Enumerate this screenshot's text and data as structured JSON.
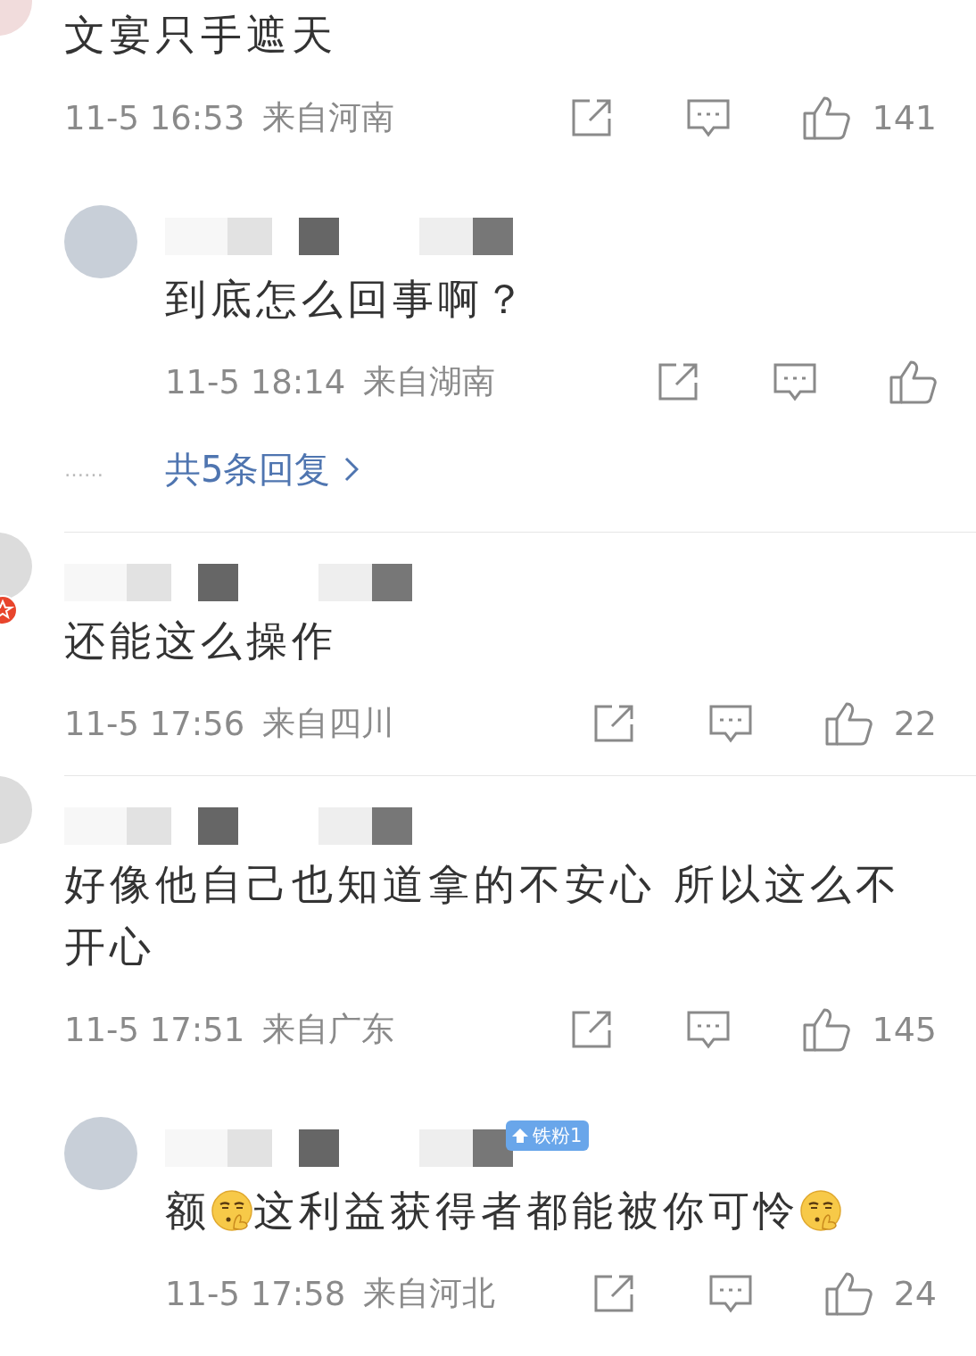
{
  "threads": [
    {
      "comment": {
        "avatar_cut": true,
        "text": [
          {
            "text": "文宴只手遮天"
          }
        ],
        "time": "11-5 16:53",
        "location": "来自河南",
        "likes": "141"
      },
      "replies": [
        {
          "name_blurred": true,
          "text": [
            {
              "text": "到底怎么回事啊？"
            }
          ],
          "time": "11-5 18:14",
          "location": "来自湖南"
        }
      ],
      "more_dots": "……",
      "more_replies": "共5条回复"
    },
    {
      "comment": {
        "name_blurred": true,
        "verified": true,
        "text": [
          {
            "text": "还能这么操作"
          }
        ],
        "time": "11-5 17:56",
        "location": "来自四川",
        "likes": "22"
      }
    },
    {
      "comment": {
        "name_blurred": true,
        "text": [
          {
            "text": "好像他自己也知道拿的不安心 所以这么不开心"
          }
        ],
        "time": "11-5 17:51",
        "location": "来自广东",
        "likes": "145"
      },
      "replies": [
        {
          "name_blurred": true,
          "badge": "铁粉1",
          "text": [
            {
              "text": "额"
            },
            {
              "kind": "emoji"
            },
            {
              "text": "这利益获得者都能被你可怜"
            },
            {
              "kind": "emoji"
            }
          ],
          "time": "11-5 17:58",
          "location": "来自河北",
          "likes": "24"
        }
      ]
    }
  ]
}
